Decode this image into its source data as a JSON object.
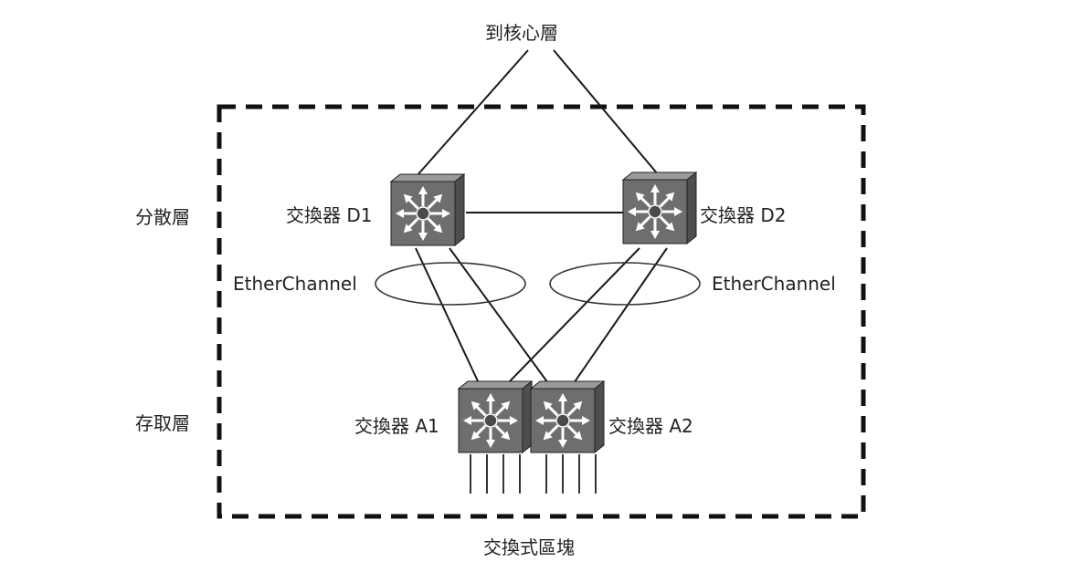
{
  "labels": {
    "to_core": "到核心層",
    "distribution_layer": "分散層",
    "access_layer": "存取層",
    "switch_block": "交換式區塊",
    "switch_d1": "交換器 D1",
    "switch_d2": "交換器 D2",
    "switch_a1": "交換器 A1",
    "switch_a2": "交換器 A2",
    "etherchannel_left": "EtherChannel",
    "etherchannel_right": "EtherChannel"
  },
  "colors": {
    "switch_face": "#6e6e6e",
    "switch_side": "#4e4e4e",
    "switch_top": "#9a9a9a",
    "line": "#1a1a1a"
  },
  "icons": [
    "multilayer-switch-icon"
  ]
}
